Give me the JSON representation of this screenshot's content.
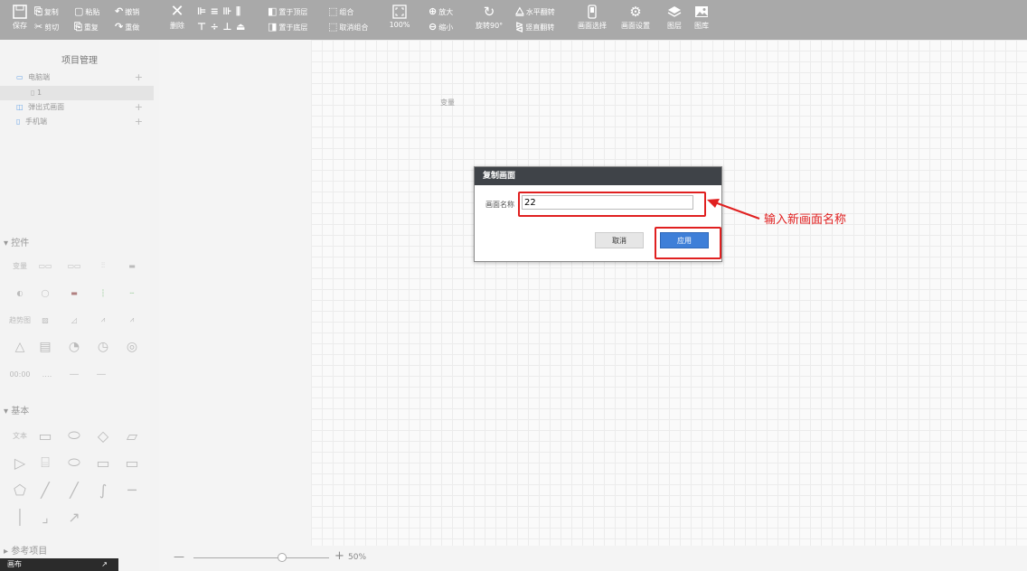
{
  "toolbar": {
    "save": "保存",
    "copy": "复制",
    "paste": "粘贴",
    "undo": "撤销",
    "cut": "剪切",
    "repeat": "重复",
    "redo": "重做",
    "delete": "删除",
    "bring_top": "置于顶层",
    "send_bottom": "置于底层",
    "group": "组合",
    "ungroup": "取消组合",
    "zoom_level": "100%",
    "zoom_in": "放大",
    "zoom_out": "缩小",
    "rotate": "旋转90°",
    "flip_h": "水平翻转",
    "flip_v": "竖直翻转",
    "screen_select": "画面选择",
    "screen_settings": "画面设置",
    "layers": "图层",
    "gallery": "图库"
  },
  "sidebar": {
    "project_title": "项目管理",
    "tree": [
      {
        "label": "电脑端",
        "plus": "+"
      },
      {
        "label": "1",
        "plus": ""
      },
      {
        "label": "弹出式画面",
        "plus": "+"
      },
      {
        "label": "手机端",
        "plus": "+"
      }
    ],
    "controls_title": "控件",
    "controls": {
      "variable": "变量",
      "clock": "00:00",
      "curve": "趋势图"
    },
    "basic_title": "基本",
    "basic": {
      "text": "文本"
    },
    "reference_title": "参考项目",
    "bottom_tab": "画布"
  },
  "canvas": {
    "text": "变量"
  },
  "dialog": {
    "title": "复制画面",
    "name_label": "画面名称",
    "name_value": "22",
    "cancel": "取消",
    "apply": "应用"
  },
  "annotation": "输入新画面名称",
  "zoom": {
    "value": "50%",
    "minus": "—",
    "plus": "+",
    "level": 0.5
  },
  "colors": {
    "accent": "#3e7fd8",
    "highlight": "#e02020",
    "dialog_header": "#3f4348"
  }
}
